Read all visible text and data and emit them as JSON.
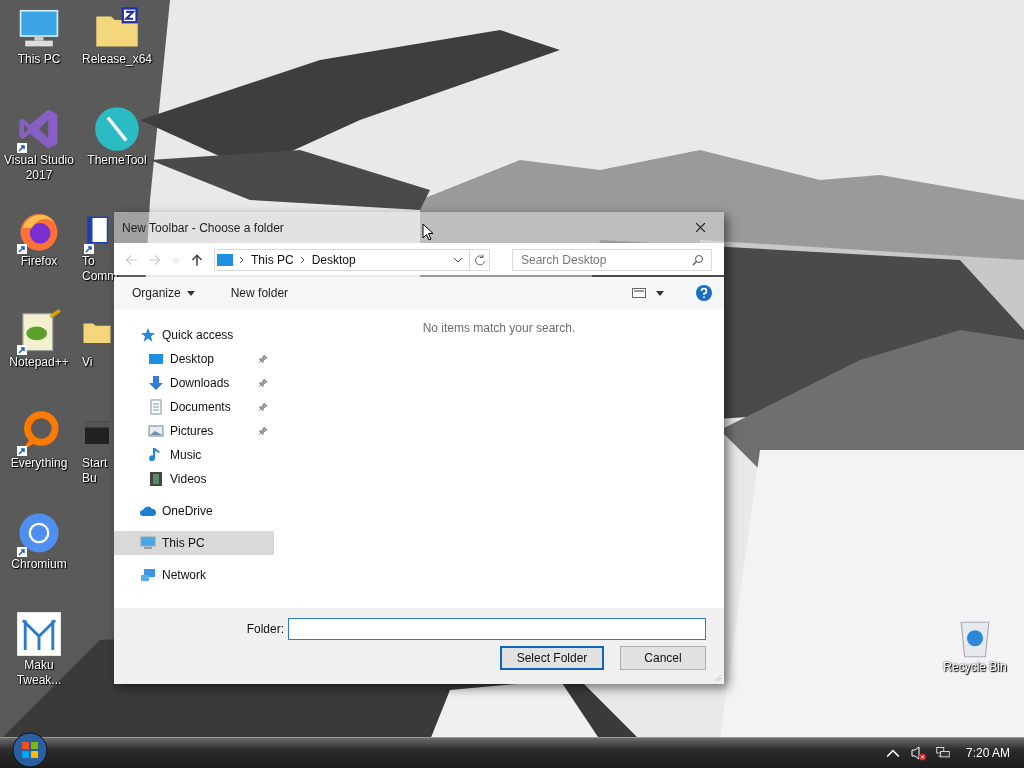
{
  "desktop": {
    "left_column": [
      {
        "kind": "pc",
        "lines": [
          "This PC"
        ]
      },
      {
        "kind": "vs",
        "lines": [
          "Visual Studio",
          "2017"
        ],
        "shortcut": true
      },
      {
        "kind": "firefox",
        "lines": [
          "Firefox"
        ],
        "shortcut": true
      },
      {
        "kind": "notepad",
        "lines": [
          "Notepad++"
        ],
        "shortcut": true
      },
      {
        "kind": "everything",
        "lines": [
          "Everything"
        ],
        "shortcut": true
      },
      {
        "kind": "chromium",
        "lines": [
          "Chromium"
        ],
        "shortcut": true
      },
      {
        "kind": "maku",
        "lines": [
          "Maku",
          "Tweak..."
        ]
      }
    ],
    "right_column": [
      {
        "kind": "zipfolder",
        "lines": [
          "Release_x64"
        ],
        "cut": false
      },
      {
        "kind": "theme",
        "lines": [
          "ThemeTool"
        ],
        "cut": false
      },
      {
        "kind": "doc",
        "lines": [
          "To",
          "Comm"
        ],
        "cut": true,
        "shortcut": true
      },
      {
        "kind": "folder",
        "lines": [
          "Vi"
        ],
        "cut": true
      },
      {
        "kind": "dark",
        "lines": [
          "Start",
          "Bu"
        ],
        "cut": true
      }
    ],
    "recycle_bin": {
      "kind": "recycle",
      "lines": [
        "Recycle Bin"
      ]
    }
  },
  "dialog": {
    "title": "New Toolbar - Choose a folder",
    "address": {
      "path": [
        "This PC",
        "Desktop"
      ]
    },
    "search": {
      "placeholder": "Search Desktop"
    },
    "commands": [
      "Organize",
      "New folder"
    ],
    "nav": [
      {
        "label": "Quick access",
        "kind": "star",
        "selected": false,
        "children": [
          {
            "label": "Desktop",
            "kind": "desktop",
            "pinned": true,
            "selected": false
          },
          {
            "label": "Downloads",
            "kind": "download",
            "pinned": true,
            "selected": false
          },
          {
            "label": "Documents",
            "kind": "document",
            "pinned": true,
            "selected": false
          },
          {
            "label": "Pictures",
            "kind": "pictures",
            "pinned": true,
            "selected": false
          },
          {
            "label": "Music",
            "kind": "music",
            "pinned": false,
            "selected": false
          },
          {
            "label": "Videos",
            "kind": "videos",
            "pinned": false,
            "selected": false
          }
        ]
      },
      {
        "label": "OneDrive",
        "kind": "cloud",
        "selected": false
      },
      {
        "label": "This PC",
        "kind": "pc",
        "selected": true
      },
      {
        "label": "Network",
        "kind": "network",
        "selected": false
      }
    ],
    "empty_message": "No items match your search.",
    "folder_label": "Folder:",
    "buttons": [
      {
        "label": "Select Folder",
        "default": true
      },
      {
        "label": "Cancel",
        "default": false
      }
    ]
  },
  "taskbar": {
    "clock": "7:20 AM",
    "volume_muted": true
  }
}
